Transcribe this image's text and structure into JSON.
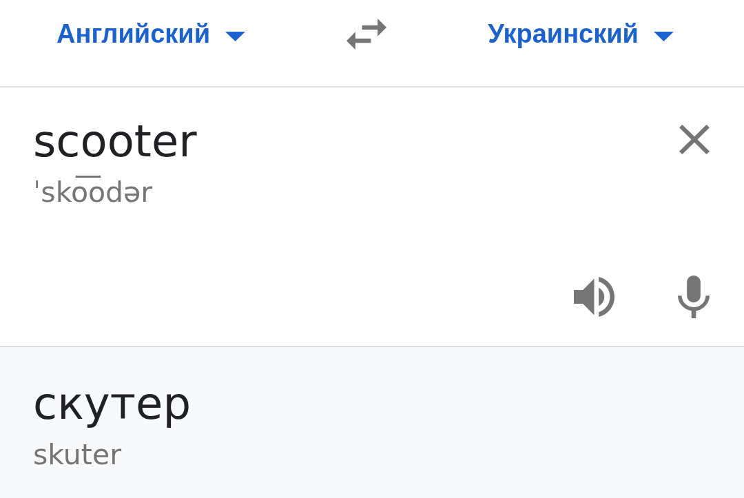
{
  "language_bar": {
    "source_language": {
      "label": "Английский"
    },
    "target_language": {
      "label": "Украинский"
    }
  },
  "source": {
    "value": "scooter",
    "transliteration": "ˈsko͞odər"
  },
  "translation": {
    "text": "скутер",
    "transliteration": "skuter"
  }
}
